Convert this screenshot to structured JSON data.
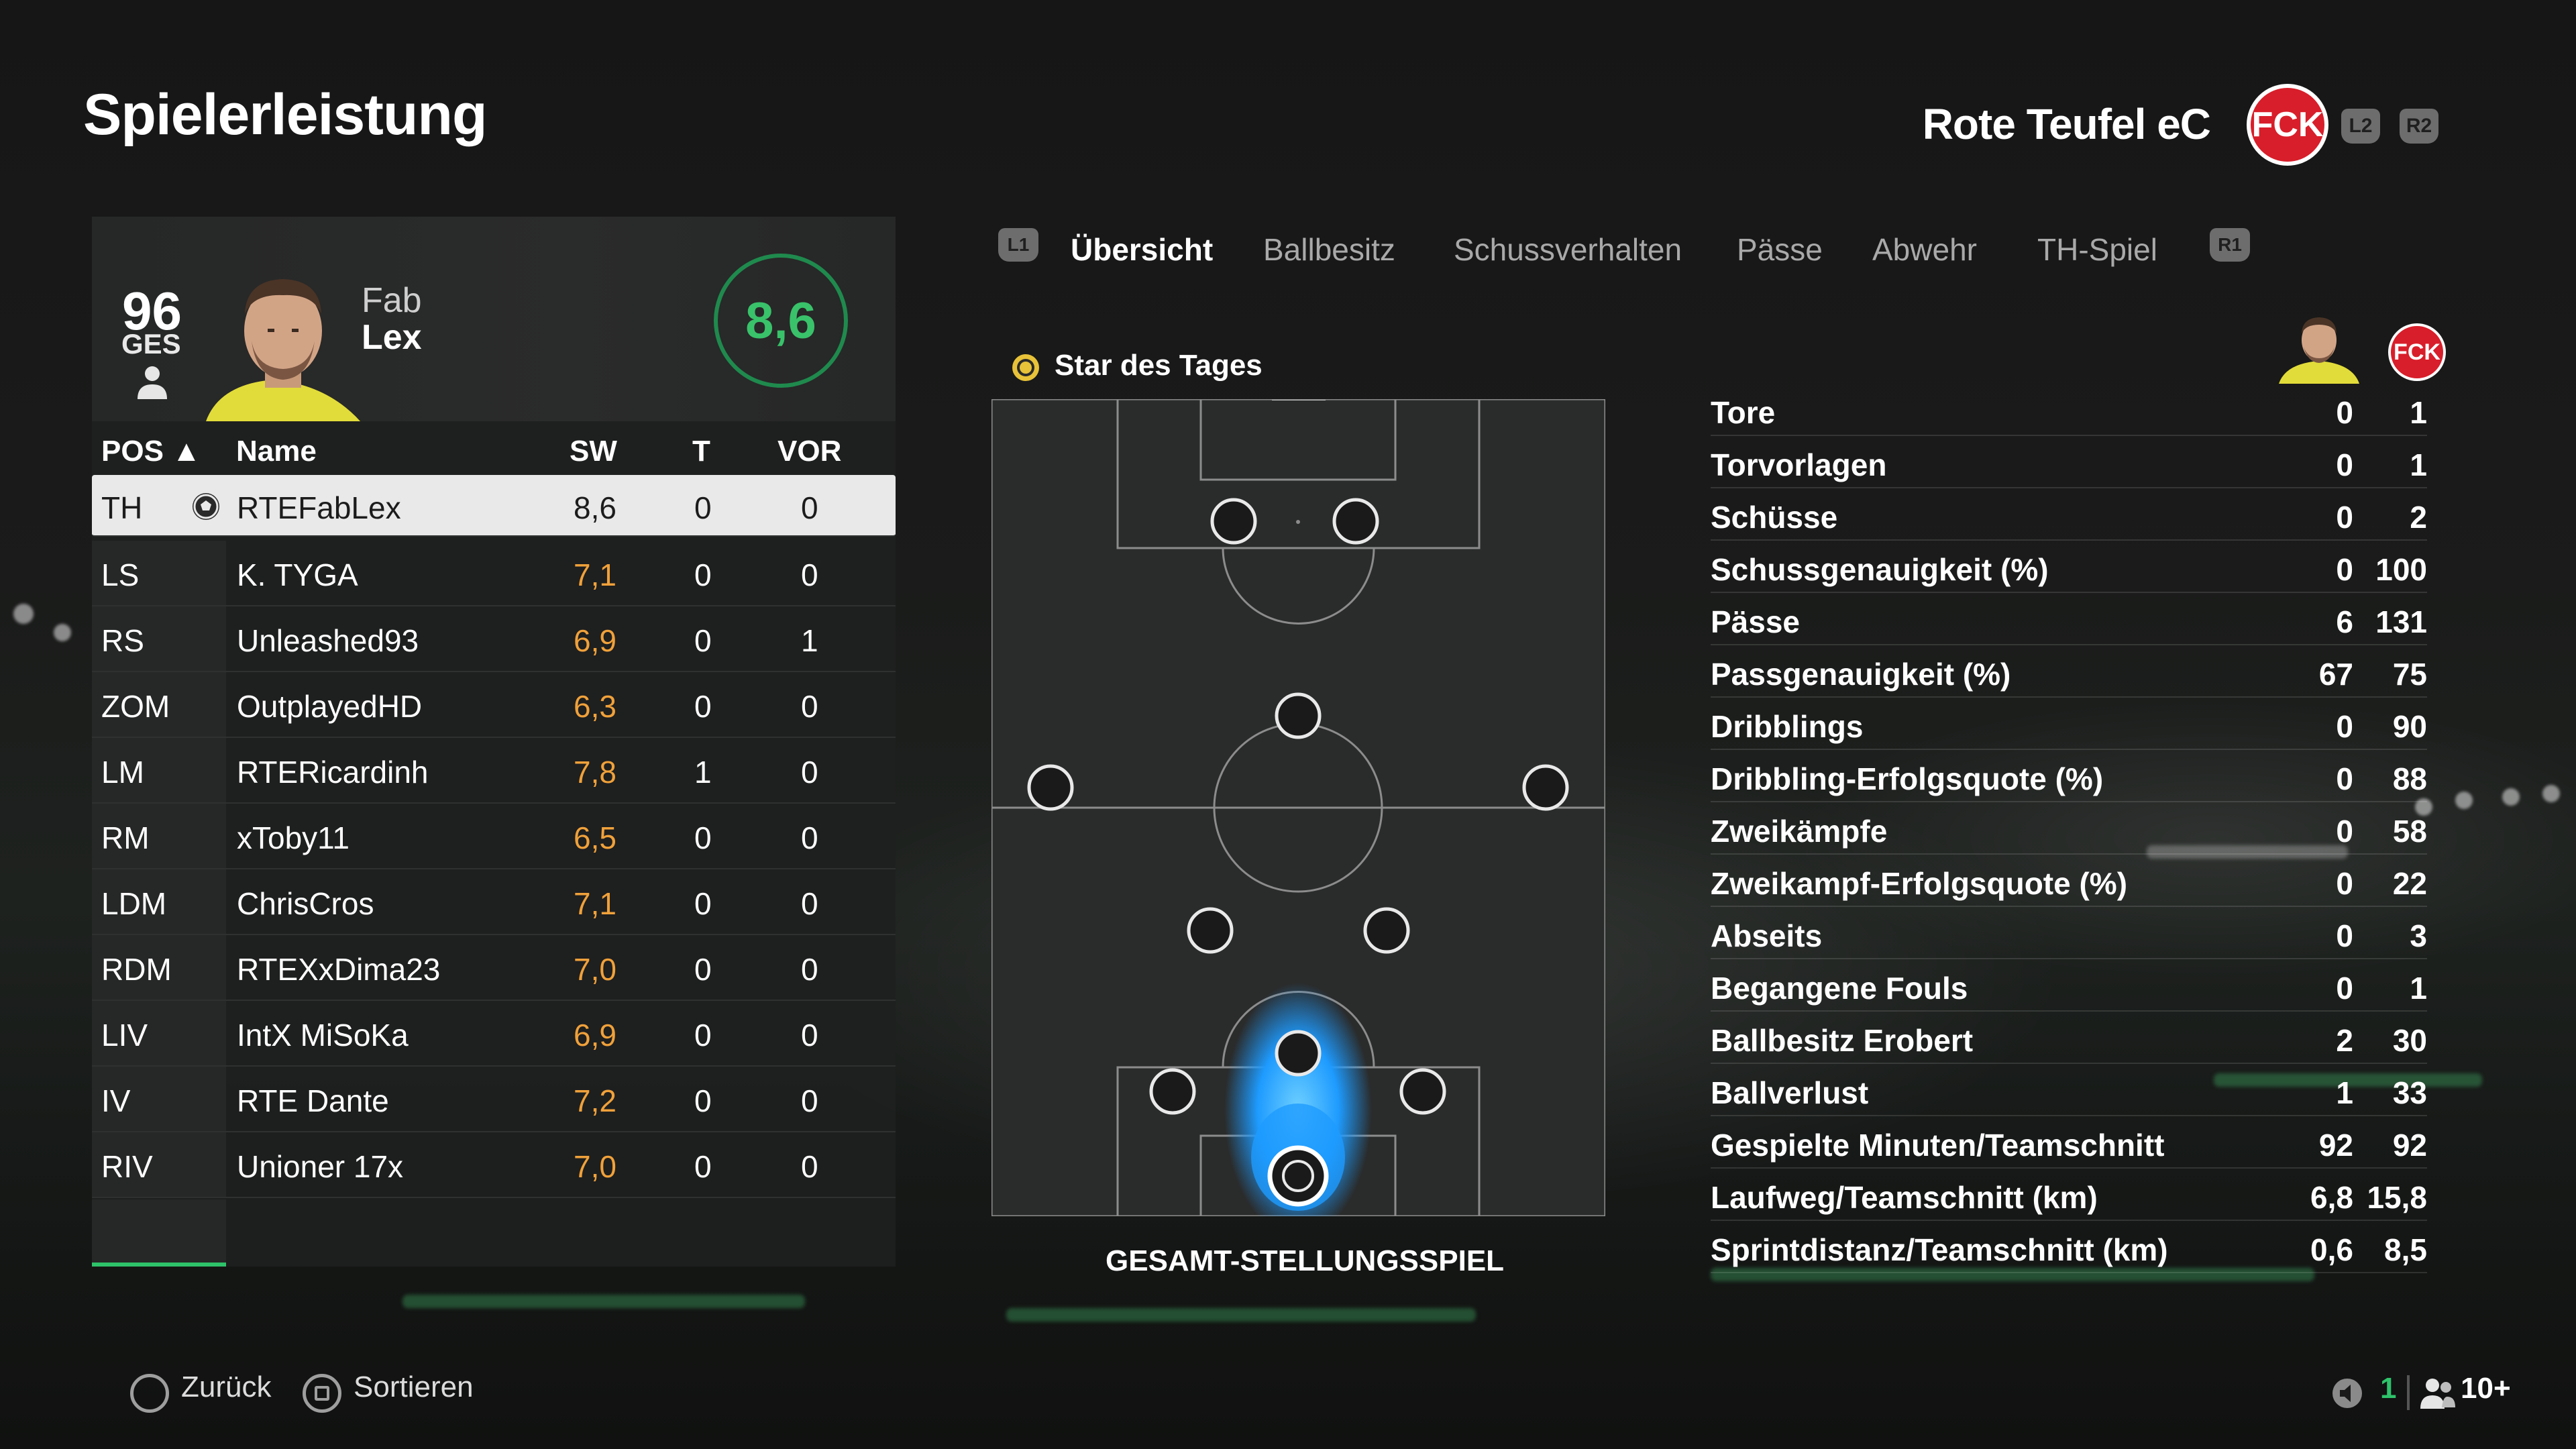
{
  "page": {
    "title": "Spielerleistung"
  },
  "club": {
    "name": "Rote Teufel eC",
    "crest_text": "FCK",
    "crest_color": "#d81e2a"
  },
  "shoulder": {
    "left": "L2",
    "right": "R2"
  },
  "player": {
    "overall": "96",
    "overall_label": "GES",
    "first_name": "Fab",
    "last_name": "Lex",
    "match_rating": "8,6"
  },
  "table": {
    "headers": {
      "pos": "POS ▲",
      "name": "Name",
      "rating": "SW",
      "goals": "T",
      "assists": "VOR"
    },
    "rows": [
      {
        "pos": "TH",
        "name": "RTEFabLex",
        "rating": "8,6",
        "goals": "0",
        "assists": "0"
      },
      {
        "pos": "LS",
        "name": "K. TYGA",
        "rating": "7,1",
        "goals": "0",
        "assists": "0"
      },
      {
        "pos": "RS",
        "name": "Unleashed93",
        "rating": "6,9",
        "goals": "0",
        "assists": "1"
      },
      {
        "pos": "ZOM",
        "name": "OutplayedHD",
        "rating": "6,3",
        "goals": "0",
        "assists": "0"
      },
      {
        "pos": "LM",
        "name": "RTERicardinh",
        "rating": "7,8",
        "goals": "1",
        "assists": "0"
      },
      {
        "pos": "RM",
        "name": "xToby11",
        "rating": "6,5",
        "goals": "0",
        "assists": "0"
      },
      {
        "pos": "LDM",
        "name": "ChrisCros",
        "rating": "7,1",
        "goals": "0",
        "assists": "0"
      },
      {
        "pos": "RDM",
        "name": "RTEXxDima23",
        "rating": "7,0",
        "goals": "0",
        "assists": "0"
      },
      {
        "pos": "LIV",
        "name": "IntX MiSoKa",
        "rating": "6,9",
        "goals": "0",
        "assists": "0"
      },
      {
        "pos": "IV",
        "name": "RTE Dante",
        "rating": "7,2",
        "goals": "0",
        "assists": "0"
      },
      {
        "pos": "RIV",
        "name": "Unioner 17x",
        "rating": "7,0",
        "goals": "0",
        "assists": "0"
      }
    ]
  },
  "tabs": {
    "l1": "L1",
    "r1": "R1",
    "items": [
      "Übersicht",
      "Ballbesitz",
      "Schussverhalten",
      "Pässe",
      "Abwehr",
      "TH-Spiel"
    ]
  },
  "star": {
    "label": "Star des Tages"
  },
  "pitch": {
    "caption": "GESAMT-STELLUNGSSPIEL",
    "heat_color": "#1e9bff"
  },
  "stats": [
    {
      "label": "Tore",
      "player": "0",
      "team": "1"
    },
    {
      "label": "Torvorlagen",
      "player": "0",
      "team": "1"
    },
    {
      "label": "Schüsse",
      "player": "0",
      "team": "2"
    },
    {
      "label": "Schussgenauigkeit (%)",
      "player": "0",
      "team": "100"
    },
    {
      "label": "Pässe",
      "player": "6",
      "team": "131"
    },
    {
      "label": "Passgenauigkeit (%)",
      "player": "67",
      "team": "75"
    },
    {
      "label": "Dribblings",
      "player": "0",
      "team": "90"
    },
    {
      "label": "Dribbling-Erfolgsquote (%)",
      "player": "0",
      "team": "88"
    },
    {
      "label": "Zweikämpfe",
      "player": "0",
      "team": "58"
    },
    {
      "label": "Zweikampf-Erfolgsquote (%)",
      "player": "0",
      "team": "22"
    },
    {
      "label": "Abseits",
      "player": "0",
      "team": "3"
    },
    {
      "label": "Begangene Fouls",
      "player": "0",
      "team": "1"
    },
    {
      "label": "Ballbesitz Erobert",
      "player": "2",
      "team": "30"
    },
    {
      "label": "Ballverlust",
      "player": "1",
      "team": "33"
    },
    {
      "label": "Gespielte Minuten/Teamschnitt",
      "player": "92",
      "team": "92"
    },
    {
      "label": "Laufweg/Teamschnitt (km)",
      "player": "6,8",
      "team": "15,8"
    },
    {
      "label": "Sprintdistanz/Teamschnitt (km)",
      "player": "0,6",
      "team": "8,5"
    }
  ],
  "footer": {
    "back": "Zurück",
    "sort": "Sortieren",
    "count_a": "1",
    "count_b": "10+",
    "accent_green": "#2ec36a"
  },
  "colors": {
    "rating_ring": "#1f8a4d",
    "rating_text": "#39c26a",
    "orange": "#f0a13a"
  }
}
